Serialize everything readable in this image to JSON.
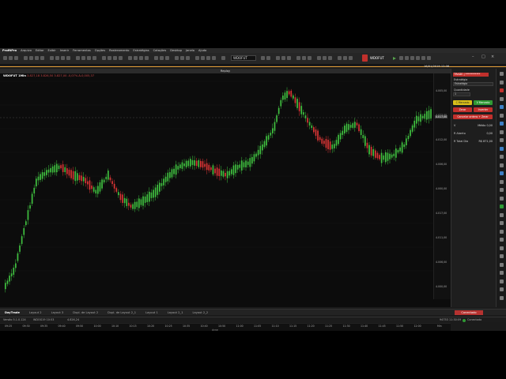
{
  "app": {
    "brand": "ProfitPro"
  },
  "menu": [
    "Arquivo",
    "Editar",
    "Exibir",
    "Inserir",
    "Ferramentas",
    "Opções",
    "Rastreamento",
    "Estratégias",
    "Cotações",
    "Desktop",
    "Janela",
    "Ajuda"
  ],
  "toolbar": {
    "ticker_select": "WDOFUT",
    "replay_ticker": "WDOFUT"
  },
  "clock": "16/01/2019 12:06",
  "replay_bar": "Replay",
  "chart": {
    "info_symbol": "WDOFUT 1Min",
    "info_values": "3.827,18  3.826,50  3.827,00  -0,07%  ∆-0,005,37",
    "last_badge": "3.827,00"
  },
  "chart_data": {
    "type": "candlestick",
    "symbol": "WDOFUT",
    "timeframe": "1Min",
    "x_ticks": [
      "09:25",
      "09:30",
      "09:35",
      "09:40",
      "09:50",
      "10:00",
      "10:10",
      "10:15",
      "10:20",
      "10:25",
      "10:35",
      "10:40",
      "10:50",
      "11:00",
      "11:05",
      "11:10",
      "11:15",
      "11:20",
      "11:25",
      "11:30",
      "11:40",
      "11:45",
      "11:50",
      "12:00"
    ],
    "y_ticks": [
      "4.005,00",
      "4.023,00",
      "4.012,00",
      "4.006,00",
      "4.000,00",
      "4.017,00",
      "4.011,00",
      "4.006,00",
      "4.000,00"
    ],
    "price_badge": "4.017,00",
    "x_label": "dyne",
    "bottom_right_label": "Min",
    "shape_points": [
      [
        0,
        0.96
      ],
      [
        12,
        0.88
      ],
      [
        25,
        0.68
      ],
      [
        40,
        0.46
      ],
      [
        55,
        0.42
      ],
      [
        70,
        0.4
      ],
      [
        85,
        0.44
      ],
      [
        100,
        0.46
      ],
      [
        115,
        0.52
      ],
      [
        130,
        0.44
      ],
      [
        145,
        0.54
      ],
      [
        160,
        0.59
      ],
      [
        175,
        0.56
      ],
      [
        190,
        0.52
      ],
      [
        205,
        0.45
      ],
      [
        220,
        0.4
      ],
      [
        235,
        0.38
      ],
      [
        250,
        0.39
      ],
      [
        265,
        0.42
      ],
      [
        280,
        0.44
      ],
      [
        295,
        0.4
      ],
      [
        310,
        0.38
      ],
      [
        325,
        0.31
      ],
      [
        340,
        0.22
      ],
      [
        350,
        0.08
      ],
      [
        360,
        0.05
      ],
      [
        372,
        0.12
      ],
      [
        385,
        0.2
      ],
      [
        400,
        0.28
      ],
      [
        415,
        0.31
      ],
      [
        430,
        0.22
      ],
      [
        445,
        0.2
      ],
      [
        460,
        0.32
      ],
      [
        475,
        0.36
      ],
      [
        490,
        0.35
      ],
      [
        505,
        0.3
      ],
      [
        520,
        0.18
      ],
      [
        533,
        0.16
      ],
      [
        540,
        0.15
      ]
    ]
  },
  "order_panel": {
    "header": "TRADE | ***********",
    "estrategia_label": "Estratégia",
    "estrategia_value": "Estratégia",
    "quantidade_label": "Quantidade",
    "quantidade_value": "1",
    "buy_market": "C Mercado",
    "sell_market": "V Mercado",
    "zerar": "Zerar",
    "inverter": "Inverter",
    "cancel_all": "Cancelar ordens + Zerar",
    "row1_label": "V",
    "row1_value": "Médio 0,00",
    "row2_label": "R Aberto",
    "row2_value": "0,00",
    "row3_label": "R Total Dia",
    "row3_value": "R$ 871,00"
  },
  "tabs": {
    "items": [
      "DayTrade",
      "Layout 2",
      "Layout 3",
      "Dupl. de Layout 2",
      "Dupl. de Layout 2_1",
      "Layout 1",
      "Layout 2_1",
      "Layout 2_2"
    ],
    "connected": "Conectado"
  },
  "status": {
    "version": "Versão 5.1.0.124",
    "ticker_info": "WDOG19 10:53",
    "count": "4.826,24",
    "right_1": "94753",
    "right_2": "11:30:09",
    "connected": "Conectado"
  }
}
